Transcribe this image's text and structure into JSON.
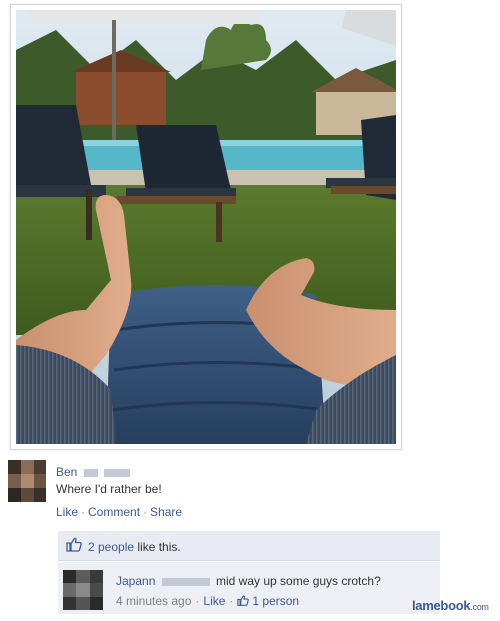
{
  "post": {
    "author": "Ben",
    "text": "Where I'd rather be!",
    "actions": {
      "like": "Like",
      "comment": "Comment",
      "share": "Share",
      "separator": "·"
    }
  },
  "likes": {
    "count_text": "2 people",
    "suffix": " like this."
  },
  "comment": {
    "author": "Japann",
    "text": "mid way up some guys crotch?",
    "time": "4 minutes ago",
    "like": "Like",
    "like_count": "1 person",
    "separator": "·"
  },
  "watermark": {
    "brand": "lamebook",
    "tld": ".com"
  },
  "colors": {
    "link": "#3b5998",
    "likes_bg": "#e9ebf2",
    "comment_bg": "#edeff4"
  }
}
